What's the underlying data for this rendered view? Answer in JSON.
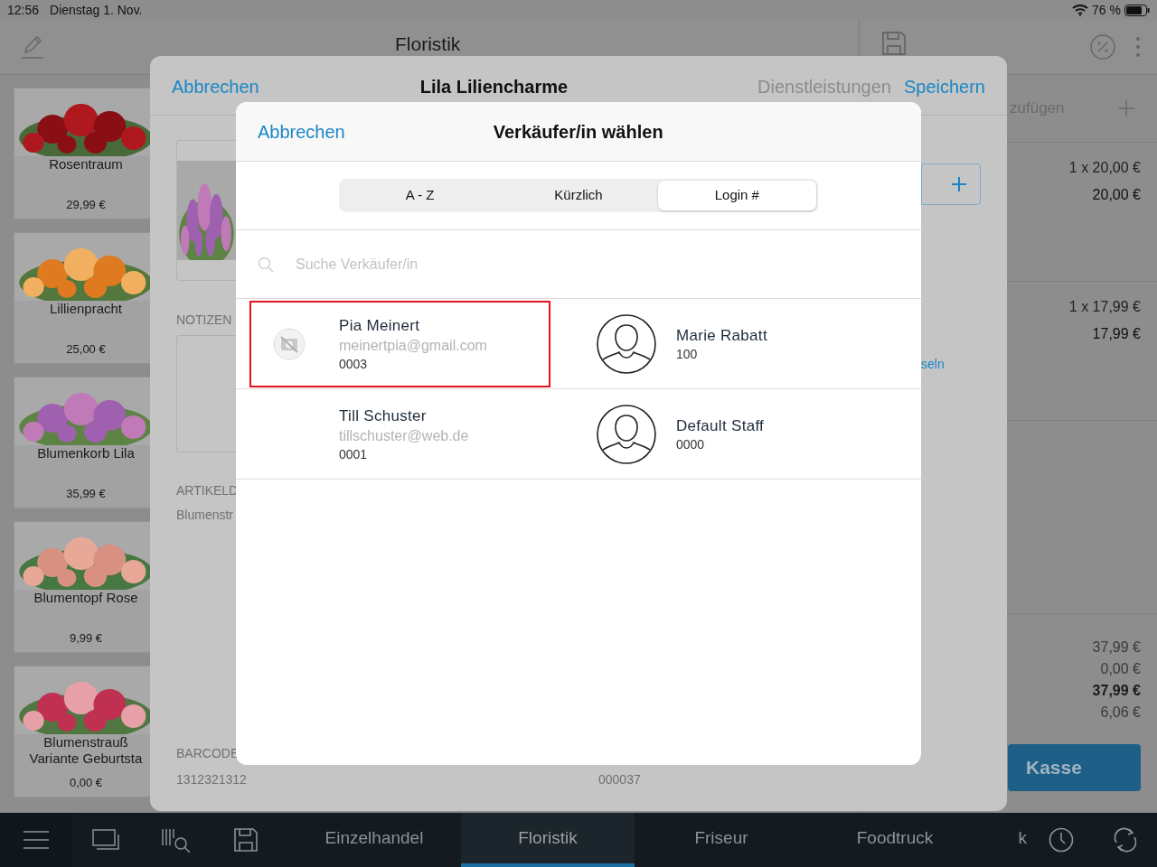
{
  "status_bar": {
    "time": "12:56",
    "date": "Dienstag 1. Nov.",
    "battery": "76 %"
  },
  "app": {
    "title": "Floristik"
  },
  "products": [
    {
      "name": "Rosentraum",
      "price": "29,99 €"
    },
    {
      "name": "Lillienpracht",
      "price": "25,00 €"
    },
    {
      "name": "Blumenkorb Lila",
      "price": "35,99 €"
    },
    {
      "name": "Blumentopf Rose",
      "price": "9,99 €"
    },
    {
      "name": "Blumenstrauß Variante Geburtsta",
      "price": "0,00 €"
    }
  ],
  "cart": {
    "add_label": "zufügen",
    "items": [
      {
        "quantity_price": "1 x 20,00 €",
        "total": "20,00 €"
      },
      {
        "quantity_price": "1 x 17,99 €",
        "total": "17,99 €"
      }
    ],
    "totals": [
      {
        "value": "37,99 €",
        "bold": false
      },
      {
        "value": "0,00 €",
        "bold": false
      },
      {
        "value": "37,99 €",
        "bold": true
      },
      {
        "value": "6,06 €",
        "bold": false
      }
    ],
    "checkout_button": "Kasse"
  },
  "tab_bar": {
    "tabs": [
      {
        "label": "Einzelhandel",
        "selected": false
      },
      {
        "label": "Floristik",
        "selected": true
      },
      {
        "label": "Friseur",
        "selected": false
      },
      {
        "label": "Foodtruck",
        "selected": false
      },
      {
        "label": "k",
        "selected": false
      }
    ]
  },
  "product_editor": {
    "cancel": "Abbrechen",
    "title": "Lila Liliencharme",
    "services": {
      "label": "Dienstleistungen",
      "disabled": true
    },
    "save": "Speichern",
    "notes_label": "NOTIZEN",
    "details_label": "ARTIKELD",
    "details_value": "Blumenstr",
    "barcode_label": "BARCODE",
    "barcode": "1312321312",
    "number": "000037",
    "link": "seln"
  },
  "staff_picker": {
    "cancel": "Abbrechen",
    "title": "Verkäufer/in wählen",
    "segments": [
      {
        "label": "A - Z",
        "selected": false
      },
      {
        "label": "Kürzlich",
        "selected": false
      },
      {
        "label": "Login #",
        "selected": true
      }
    ],
    "search": {
      "placeholder": "Suche Verkäufer/in"
    },
    "staff": [
      {
        "name": "Pia Meinert",
        "email": "meinertpia@gmail.com",
        "code": "0003",
        "kind": "no_photo",
        "highlighted": true
      },
      {
        "name": "Marie Rabatt",
        "code": "100",
        "kind": "silhouette",
        "highlighted": false
      },
      {
        "name": "Till Schuster",
        "email": "tillschuster@web.de",
        "code": "0001",
        "kind": "none",
        "highlighted": false
      },
      {
        "name": "Default Staff",
        "code": "0000",
        "kind": "silhouette",
        "highlighted": false
      }
    ]
  }
}
